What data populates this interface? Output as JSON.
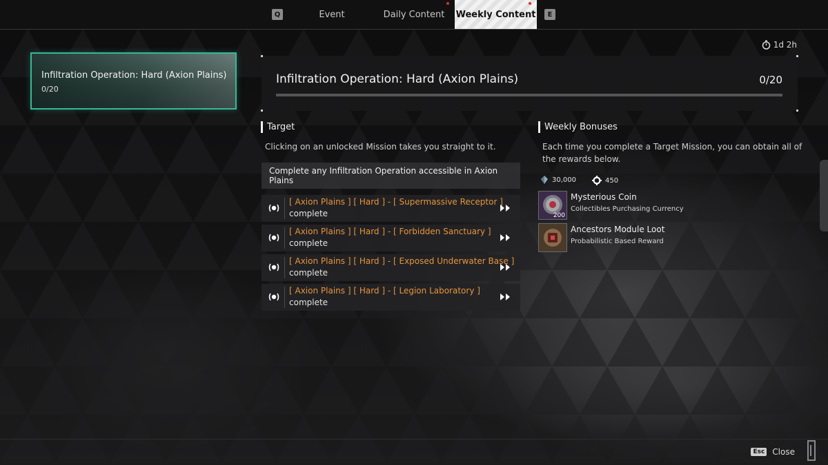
{
  "tabs": {
    "prev_key": "Q",
    "next_key": "E",
    "items": [
      {
        "label": "Event"
      },
      {
        "label": "Daily Content"
      },
      {
        "label": "Weekly Content"
      }
    ]
  },
  "left_card": {
    "title": "Infiltration Operation: Hard (Axion Plains)",
    "count": "0/20"
  },
  "timer": {
    "text": "1d 2h",
    "icon": "stopwatch-icon"
  },
  "header": {
    "title": "Infiltration Operation: Hard (Axion Plains)",
    "count": "0/20",
    "progress": 0
  },
  "target": {
    "heading": "Target",
    "description": "Clicking on an unlocked Mission takes you straight to it.",
    "condition": "Complete any Infiltration Operation accessible in Axion Plains",
    "missions": [
      {
        "name": "[ Axion Plains ] [ Hard ] - [ Supermassive Receptor ]",
        "status": "complete"
      },
      {
        "name": "[ Axion Plains ] [ Hard ] - [ Forbidden Sanctuary ]",
        "status": "complete"
      },
      {
        "name": "[ Axion Plains ] [ Hard ] - [ Exposed Underwater Base ]",
        "status": "complete"
      },
      {
        "name": "[ Axion Plains ] [ Hard ] - [ Legion Laboratory ]",
        "status": "complete"
      }
    ]
  },
  "weekly": {
    "heading": "Weekly Bonuses",
    "description": "Each time you complete a Target Mission, you can obtain all of the rewards below.",
    "currencies": [
      {
        "icon": "crystal-icon",
        "amount": "30,000"
      },
      {
        "icon": "gear-icon",
        "amount": "450"
      }
    ],
    "rewards": [
      {
        "name": "Mysterious Coin",
        "sub": "Collectibles Purchasing Currency",
        "qty": "200",
        "icon": "coin-icon"
      },
      {
        "name": "Ancestors Module Loot",
        "sub": "Probabilistic Based Reward",
        "icon": "module-loot-icon"
      }
    ]
  },
  "footer": {
    "esc_key": "Esc",
    "close_label": "Close"
  },
  "colors": {
    "accent": "#37b995",
    "mission_orange": "#e8943c",
    "tab_alert": "#e03030"
  }
}
